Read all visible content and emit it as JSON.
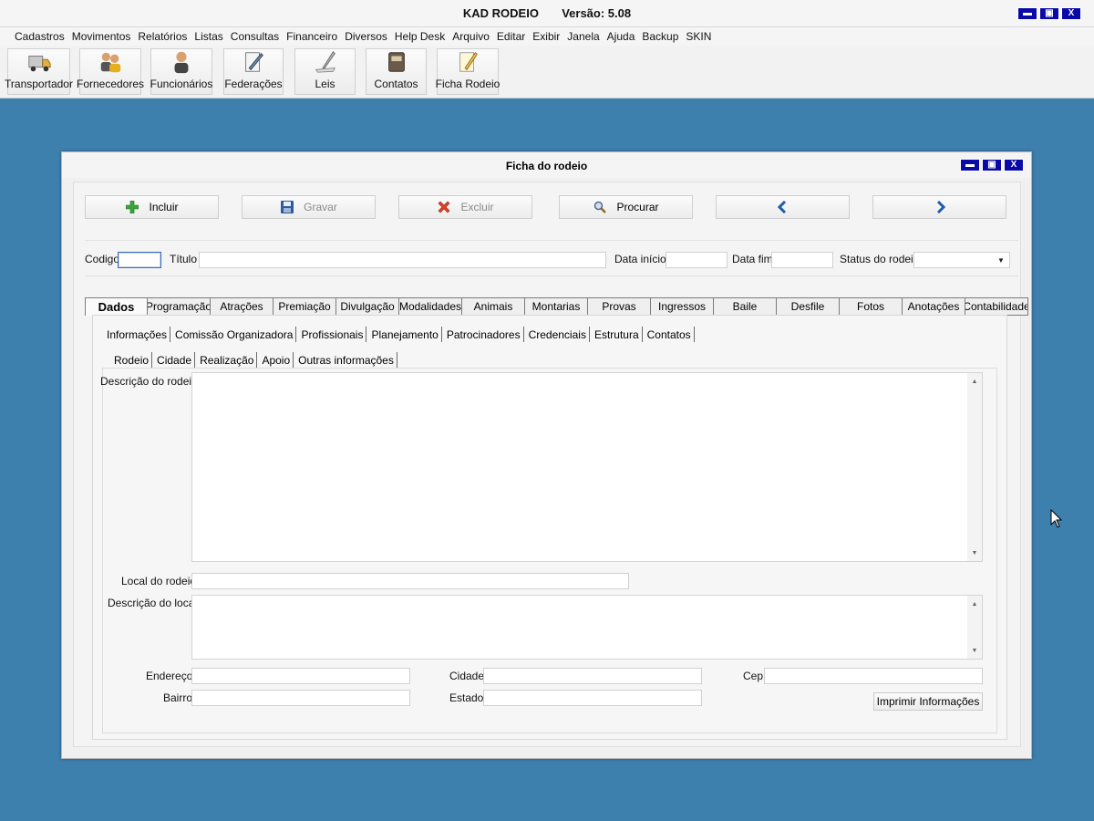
{
  "app": {
    "title": "KAD RODEIO",
    "version": "Versão: 5.08"
  },
  "window_controls": {
    "minimize": "▬",
    "maximize": "▣",
    "close": "X"
  },
  "menu": [
    "Cadastros",
    "Movimentos",
    "Relatórios",
    "Listas",
    "Consultas",
    "Financeiro",
    "Diversos",
    "Help Desk",
    "Arquivo",
    "Editar",
    "Exibir",
    "Janela",
    "Ajuda",
    "Backup",
    "SKIN"
  ],
  "toolbar": [
    {
      "label": "Transportador",
      "icon": "truck-icon"
    },
    {
      "label": "Fornecedores",
      "icon": "suppliers-icon"
    },
    {
      "label": "Funcionários",
      "icon": "employee-icon"
    },
    {
      "label": "Federações",
      "icon": "document-pen-icon"
    },
    {
      "label": "Leis",
      "icon": "law-feather-icon"
    },
    {
      "label": "Contatos",
      "icon": "address-book-icon"
    },
    {
      "label": "Ficha Rodeio",
      "icon": "notepad-pencil-icon"
    }
  ],
  "child": {
    "title": "Ficha do rodeio",
    "buttons": {
      "incluir": "Incluir",
      "gravar": "Gravar",
      "excluir": "Excluir",
      "procurar": "Procurar"
    },
    "fields": {
      "codigo_label": "Codigo",
      "codigo_value": "",
      "titulo_label": "Título",
      "titulo_value": "",
      "data_inicio_label": "Data início",
      "data_inicio_value": "",
      "data_fim_label": "Data fim",
      "data_fim_value": "",
      "status_label": "Status do rodeio",
      "status_value": ""
    },
    "main_tabs": [
      "Dados",
      "Programação",
      "Atrações",
      "Premiação",
      "Divulgação",
      "Modalidades",
      "Animais",
      "Montarias",
      "Provas",
      "Ingressos",
      "Baile",
      "Desfile",
      "Fotos",
      "Anotações",
      "Contabilidade"
    ],
    "active_main_tab": "Dados",
    "sub_tabs": [
      "Informações",
      "Comissão Organizadora",
      "Profissionais",
      "Planejamento",
      "Patrocinadores",
      "Credenciais",
      "Estrutura",
      "Contatos"
    ],
    "sub_sub_tabs": [
      "Rodeio",
      "Cidade",
      "Realização",
      "Apoio",
      "Outras informações"
    ],
    "form": {
      "descricao_rodeio_label": "Descrição do rodeio",
      "descricao_rodeio_value": "",
      "local_rodeio_label": "Local do rodeio",
      "local_rodeio_value": "",
      "descricao_local_label": "Descrição do local",
      "descricao_local_value": "",
      "endereco_label": "Endereço",
      "endereco_value": "",
      "bairro_label": "Bairro",
      "bairro_value": "",
      "cidade_label": "Cidade",
      "cidade_value": "",
      "estado_label": "Estado",
      "estado_value": "",
      "cep_label": "Cep",
      "cep_value": "",
      "print_label": "Imprimir Informações"
    }
  },
  "colors": {
    "desktop": "#3d7fad",
    "window_button": "#0a0aa8",
    "arrow_blue": "#1f5fa8"
  }
}
